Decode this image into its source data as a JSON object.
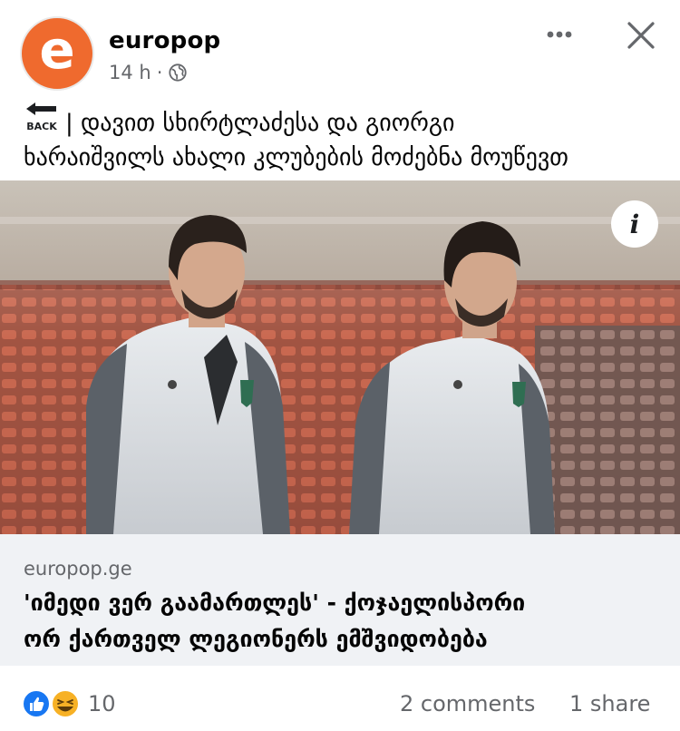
{
  "post": {
    "page_name": "europop",
    "avatar_letter": "e",
    "time": "14 h",
    "separator": "·",
    "caption_line1": "| დავით სხირტლაძესა და გიორგი",
    "caption_line2": "ხარაიშვილს ახალი კლუბების მოძებნა მოუწევთ",
    "back_icon_text": "BACK"
  },
  "link": {
    "domain": "europop.ge",
    "headline_line1": "'იმედი ვერ გაამართლეს' - ქოჯაელისპორი",
    "headline_line2": "ორ ქართველ ლეგიონერს ემშვიდობება"
  },
  "footer": {
    "reaction_count": "10",
    "comments": "2 comments",
    "shares": "1 share"
  },
  "colors": {
    "brand_orange": "#ef6a2e",
    "like_blue": "#1877f2",
    "haha_yellow": "#f7b125",
    "card_bg": "#f0f2f5",
    "muted_text": "#65676b"
  },
  "icons": {
    "more": "more-horizontal-icon",
    "close": "close-icon",
    "privacy": "globe-icon",
    "back": "back-arrow-icon",
    "info": "info-icon",
    "like": "like-reaction-icon",
    "haha": "haha-reaction-icon"
  }
}
